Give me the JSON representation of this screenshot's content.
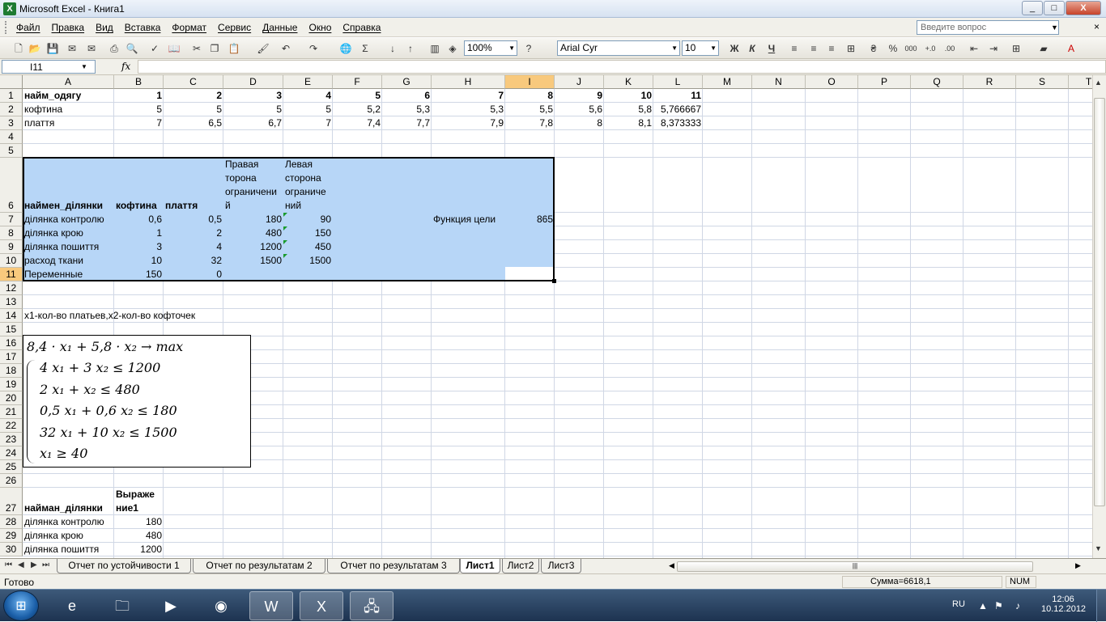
{
  "window": {
    "title": "Microsoft Excel - Книга1",
    "min": "_",
    "max": "□",
    "close": "X"
  },
  "menu": {
    "items": [
      "Файл",
      "Правка",
      "Вид",
      "Вставка",
      "Формат",
      "Сервис",
      "Данные",
      "Окно",
      "Справка"
    ],
    "ask_placeholder": "Введите вопрос",
    "close": "× "
  },
  "toolbar": {
    "zoom": "100%",
    "font": "Arial Cyr",
    "size": "10"
  },
  "formula_bar": {
    "namebox": "I11",
    "fx": "fx",
    "content": ""
  },
  "columns": [
    "A",
    "B",
    "C",
    "D",
    "E",
    "F",
    "G",
    "H",
    "I",
    "J",
    "K",
    "L",
    "M",
    "N",
    "O",
    "P",
    "Q",
    "R",
    "S",
    "T"
  ],
  "rows": [
    "1",
    "2",
    "3",
    "4",
    "5",
    "6",
    "7",
    "8",
    "9",
    "10",
    "11",
    "12",
    "13",
    "14",
    "15",
    "16",
    "17",
    "18",
    "19",
    "20",
    "21",
    "22",
    "23",
    "24",
    "25",
    "26",
    "27",
    "28",
    "29",
    "30"
  ],
  "selection": {
    "col": "I",
    "row": "11",
    "colors": {
      "header": "#f8c97d",
      "range": "#b7d6f7"
    }
  },
  "cells": {
    "A1": "найм_одягу",
    "B1": "1",
    "C1": "2",
    "D1": "3",
    "E1": "4",
    "F1": "5",
    "G1": "6",
    "H1": "7",
    "I1": "8",
    "J1": "9",
    "K1": "10",
    "L1": "11",
    "A2": "кофтина",
    "B2": "5",
    "C2": "5",
    "D2": "5",
    "E2": "5",
    "F2": "5,2",
    "G2": "5,3",
    "H2": "5,3",
    "I2": "5,5",
    "J2": "5,6",
    "K2": "5,8",
    "L2": "5,766667",
    "A3": "плаття",
    "B3": "7",
    "C3": "6,5",
    "D3": "6,7",
    "E3": "7",
    "F3": "7,4",
    "G3": "7,7",
    "H3": "7,9",
    "I3": "7,8",
    "J3": "8",
    "K3": "8,1",
    "L3": "8,373333",
    "A6": "наймен_ділянки",
    "B6": "кофтина",
    "C6": "плаття",
    "D6": [
      "Правая",
      "торона",
      "ограничени",
      "й"
    ],
    "E6": [
      "Левая",
      "сторона",
      "ограниче",
      "ний"
    ],
    "A7": " ділянка контролю",
    "B7": "0,6",
    "C7": "0,5",
    "D7": "180",
    "E7": "90",
    "H7": "Функция цели",
    "I7": "865",
    "A8": "ділянка крою",
    "B8": "1",
    "C8": "2",
    "D8": "480",
    "E8": "150",
    "A9": "ділянка пошиття",
    "B9": "3",
    "C9": "4",
    "D9": "1200",
    "E9": "450",
    "A10": "расход ткани",
    "B10": "10",
    "C10": "32",
    "D10": "1500",
    "E10": "1500",
    "A11": "Переменные",
    "B11": "150",
    "C11": "0",
    "A14": "x1-кол-во платьев,x2-кол-во кофточек",
    "A27": "найман_ділянки",
    "B27": [
      "Выраже",
      "ние1"
    ],
    "A28": " ділянка контролю",
    "B28": "180",
    "A29": "ділянка крою",
    "B29": "480",
    "A30": "ділянка пошиття",
    "B30": "1200"
  },
  "formula_object": {
    "objective": "8,4 · x₁ + 5,8 · x₂ →   max",
    "constraints": [
      "4 x₁ + 3 x₂ ≤ 1200",
      "2 x₁ + x₂ ≤ 480",
      "0,5 x₁ + 0,6 x₂ ≤ 180",
      "32 x₁ + 10 x₂ ≤ 1500",
      "x₁ ≥ 40"
    ]
  },
  "sheet_tabs": {
    "tabs": [
      "Отчет по устойчивости 1",
      "Отчет по результатам 2",
      "Отчет по результатам 3",
      "Лист1",
      "Лист2",
      "Лист3"
    ],
    "active": "Лист1"
  },
  "status": {
    "ready": "Готово",
    "sum": "Сумма=6618,1",
    "num": "NUM"
  },
  "taskbar": {
    "lang": "RU",
    "time": "12:06",
    "date": "10.12.2012"
  }
}
